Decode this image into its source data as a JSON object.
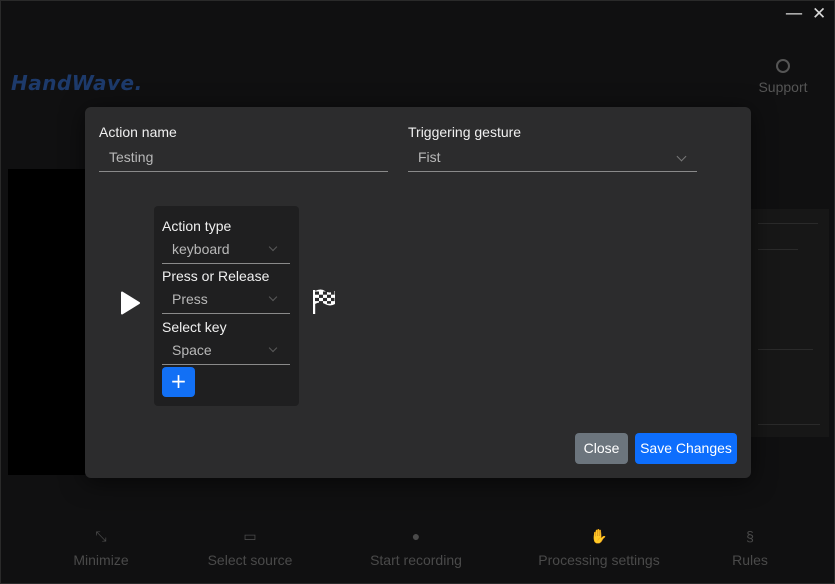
{
  "window": {
    "minimize_glyph": "—",
    "close_glyph": "✕"
  },
  "app": {
    "logo": "HandWave.",
    "support_label": "Support",
    "bottom_bar": [
      {
        "label": "Minimize",
        "icon": "shrink-icon"
      },
      {
        "label": "Select source",
        "icon": "monitor-icon"
      },
      {
        "label": "Start recording",
        "icon": "record-icon"
      },
      {
        "label": "Processing settings",
        "icon": "hand-icon"
      },
      {
        "label": "Rules",
        "icon": "section-icon"
      }
    ]
  },
  "modal": {
    "action_name": {
      "label": "Action name",
      "value": "Testing"
    },
    "triggering_gesture": {
      "label": "Triggering gesture",
      "value": "Fist"
    },
    "action_card": {
      "action_type": {
        "label": "Action type",
        "value": "keyboard"
      },
      "press_or_release": {
        "label": "Press or Release",
        "value": "Press"
      },
      "select_key": {
        "label": "Select key",
        "value": "Space"
      },
      "add_label": "+"
    },
    "close_label": "Close",
    "save_label": "Save Changes"
  },
  "colors": {
    "primary": "#0d6efd",
    "secondary": "#6c757d",
    "modal_bg": "#2c2c2d",
    "card_bg": "#1f1f20"
  }
}
